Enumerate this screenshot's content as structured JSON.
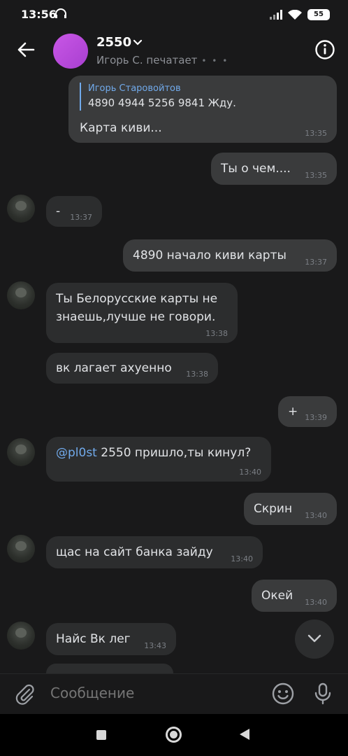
{
  "status_bar": {
    "time": "13:56",
    "battery": "55",
    "icons": [
      "headphones-icon",
      "signal-icon",
      "wifi-icon",
      "battery-icon"
    ]
  },
  "header": {
    "title": "2550",
    "typing_status": "Игорь С. печатает",
    "typing_dots": "• • •"
  },
  "messages": [
    {
      "dir": "out",
      "reply_author": "Игорь Старовойтов",
      "reply_text": "4890 4944 5256 9841 Жду.",
      "text": "Карта киви...",
      "time": "13:35"
    },
    {
      "dir": "out",
      "text": "Ты о чем....",
      "time": "13:35"
    },
    {
      "dir": "in",
      "text": "-",
      "time": "13:37"
    },
    {
      "dir": "out",
      "text": "4890 начало киви карты",
      "time": "13:37"
    },
    {
      "dir": "in",
      "text_line1": "Ты Белорусские карты не",
      "text_line2": "знаешь,лучше не говори.",
      "time": "13:38"
    },
    {
      "dir": "in",
      "text": "вк лагает ахуенно",
      "time": "13:38"
    },
    {
      "dir": "out",
      "text": "+",
      "time": "13:39"
    },
    {
      "dir": "in",
      "mention": "@pl0st",
      "text": " 2550 пришло,ты кинул?",
      "time": "13:40"
    },
    {
      "dir": "out",
      "text": "Скрин",
      "time": "13:40"
    },
    {
      "dir": "in",
      "text": "щас на сайт банка зайду",
      "time": "13:40"
    },
    {
      "dir": "out",
      "text": "Окей",
      "time": "13:40"
    },
    {
      "dir": "in",
      "text": "Найс Вк лег",
      "time": "13:43"
    }
  ],
  "composer": {
    "placeholder": "Сообщение"
  },
  "colors": {
    "background": "#19191a",
    "bubble_in": "#2c2d2e",
    "bubble_out": "#3a3b3c",
    "accent": "#71aaeb",
    "avatar_main": "#c957e6"
  }
}
